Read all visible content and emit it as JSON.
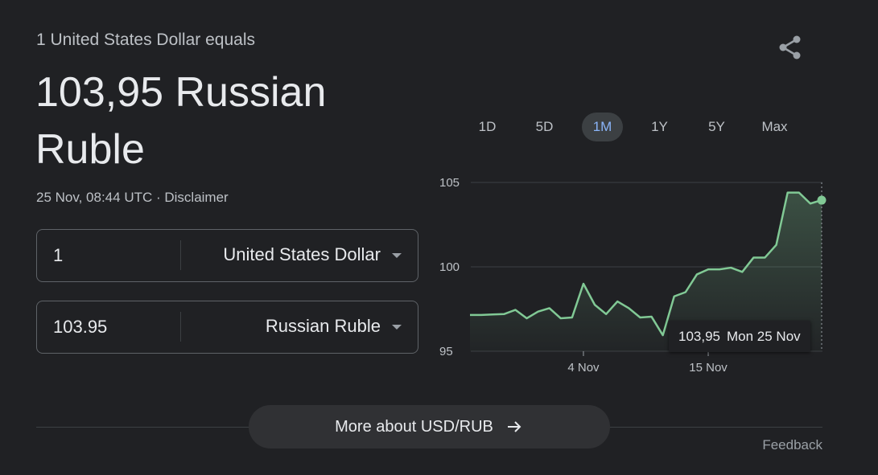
{
  "header": {
    "subtitle": "1 United States Dollar equals",
    "value_line1": "103,95 Russian",
    "value_line2": "Ruble",
    "timestamp": "25 Nov, 08:44 UTC",
    "separator": " · ",
    "disclaimer": "Disclaimer",
    "share_icon": "share-icon"
  },
  "converter": {
    "from": {
      "amount": "1",
      "currency": "United States Dollar"
    },
    "to": {
      "amount": "103.95",
      "currency": "Russian Ruble"
    }
  },
  "tabs": [
    {
      "label": "1D",
      "active": false
    },
    {
      "label": "5D",
      "active": false
    },
    {
      "label": "1M",
      "active": true
    },
    {
      "label": "1Y",
      "active": false
    },
    {
      "label": "5Y",
      "active": false
    },
    {
      "label": "Max",
      "active": false
    }
  ],
  "tooltip": {
    "value": "103,95",
    "date": "Mon 25 Nov"
  },
  "footer": {
    "more_label": "More about USD/RUB",
    "feedback": "Feedback"
  },
  "colors": {
    "background": "#202124",
    "line": "#81c995",
    "active_tab_text": "#8ab4f8"
  },
  "chart_data": {
    "type": "area",
    "x_start": "25 Oct",
    "x_end": "25 Nov",
    "x_tick_labels": [
      {
        "label": "4 Nov",
        "x": 10
      },
      {
        "label": "15 Nov",
        "x": 21
      }
    ],
    "y_tick_labels": [
      "105",
      "100",
      "95"
    ],
    "y_ticks": [
      105,
      100,
      95
    ],
    "ylim": [
      95,
      105
    ],
    "grid": true,
    "x": [
      0,
      1,
      2,
      3,
      4,
      5,
      6,
      7,
      8,
      9,
      10,
      11,
      12,
      13,
      14,
      15,
      16,
      17,
      18,
      19,
      20,
      21,
      22,
      23,
      24,
      25,
      26,
      27,
      28,
      29,
      30,
      31
    ],
    "values": [
      97.15,
      97.15,
      97.18,
      97.2,
      97.45,
      96.95,
      97.35,
      97.55,
      96.95,
      97.0,
      99.0,
      97.75,
      97.2,
      97.95,
      97.55,
      97.0,
      97.05,
      95.95,
      98.25,
      98.5,
      99.55,
      99.85,
      99.85,
      99.95,
      99.7,
      100.55,
      100.55,
      101.3,
      104.4,
      104.4,
      103.75,
      103.95
    ],
    "last_point": {
      "x": 31,
      "y": 103.95
    }
  }
}
